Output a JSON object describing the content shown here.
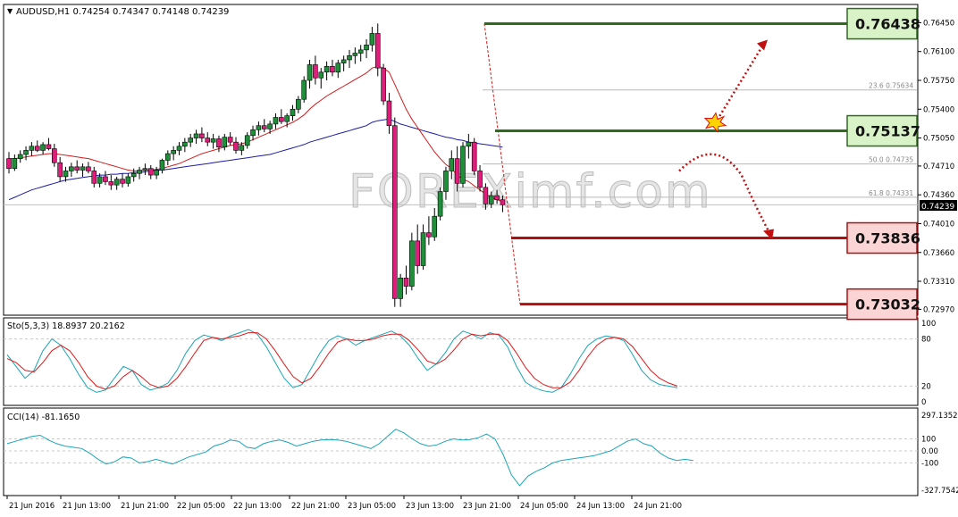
{
  "symbol_header": "AUDUSD,H1  0.74254 0.74347 0.74148 0.74239",
  "watermark": "FOREXimf.com",
  "chart_data": {
    "type": "candlestick",
    "price_axis": {
      "ticks": [
        "0.76450",
        "0.76100",
        "0.75750",
        "0.75400",
        "0.75050",
        "0.74710",
        "0.74360",
        "0.74010",
        "0.73660",
        "0.73310",
        "0.72970"
      ],
      "tick_values": [
        0.7645,
        0.761,
        0.7575,
        0.754,
        0.7505,
        0.7471,
        0.7436,
        0.7401,
        0.7366,
        0.7331,
        0.7297
      ],
      "current_price": "0.74239",
      "range": [
        0.7292,
        0.7665
      ]
    },
    "time_axis": [
      "21 Jun 2016",
      "21 Jun 13:00",
      "21 Jun 21:00",
      "22 Jun 05:00",
      "22 Jun 13:00",
      "22 Jun 21:00",
      "23 Jun 05:00",
      "23 Jun 13:00",
      "23 Jun 21:00",
      "24 Jun 05:00",
      "24 Jun 13:00",
      "24 Jun 21:00"
    ],
    "candles": [
      [
        0.748,
        0.7488,
        0.7462,
        0.7468
      ],
      [
        0.7468,
        0.7485,
        0.7465,
        0.748
      ],
      [
        0.748,
        0.749,
        0.7475,
        0.7485
      ],
      [
        0.7485,
        0.7495,
        0.7478,
        0.749
      ],
      [
        0.749,
        0.75,
        0.7483,
        0.7495
      ],
      [
        0.7495,
        0.7502,
        0.7488,
        0.749
      ],
      [
        0.749,
        0.75,
        0.7485,
        0.7497
      ],
      [
        0.7497,
        0.7505,
        0.749,
        0.7492
      ],
      [
        0.7492,
        0.7498,
        0.747,
        0.7475
      ],
      [
        0.7475,
        0.7482,
        0.7452,
        0.7458
      ],
      [
        0.7458,
        0.747,
        0.7452,
        0.7465
      ],
      [
        0.7465,
        0.7475,
        0.7458,
        0.747
      ],
      [
        0.747,
        0.7478,
        0.7462,
        0.7466
      ],
      [
        0.7466,
        0.7474,
        0.7458,
        0.747
      ],
      [
        0.747,
        0.7476,
        0.7462,
        0.7465
      ],
      [
        0.7465,
        0.747,
        0.7445,
        0.745
      ],
      [
        0.745,
        0.7462,
        0.7445,
        0.7458
      ],
      [
        0.7458,
        0.7465,
        0.7448,
        0.7452
      ],
      [
        0.7452,
        0.746,
        0.7442,
        0.7448
      ],
      [
        0.7448,
        0.7458,
        0.7442,
        0.7455
      ],
      [
        0.7455,
        0.7462,
        0.7445,
        0.745
      ],
      [
        0.745,
        0.7462,
        0.7446,
        0.7458
      ],
      [
        0.7458,
        0.7468,
        0.7452,
        0.7462
      ],
      [
        0.7462,
        0.747,
        0.7455,
        0.7466
      ],
      [
        0.7466,
        0.7474,
        0.746,
        0.7468
      ],
      [
        0.7468,
        0.7472,
        0.7455,
        0.746
      ],
      [
        0.746,
        0.747,
        0.7455,
        0.7466
      ],
      [
        0.7466,
        0.748,
        0.7462,
        0.7478
      ],
      [
        0.7478,
        0.749,
        0.7472,
        0.7486
      ],
      [
        0.7486,
        0.7495,
        0.7478,
        0.749
      ],
      [
        0.749,
        0.75,
        0.7484,
        0.7495
      ],
      [
        0.7495,
        0.7505,
        0.7488,
        0.75
      ],
      [
        0.75,
        0.751,
        0.7494,
        0.7505
      ],
      [
        0.7505,
        0.7515,
        0.7498,
        0.751
      ],
      [
        0.751,
        0.7518,
        0.75,
        0.7505
      ],
      [
        0.7505,
        0.7512,
        0.7495,
        0.75
      ],
      [
        0.75,
        0.751,
        0.7492,
        0.7504
      ],
      [
        0.7504,
        0.7508,
        0.7488,
        0.7494
      ],
      [
        0.7494,
        0.751,
        0.749,
        0.7506
      ],
      [
        0.7506,
        0.7512,
        0.7496,
        0.75
      ],
      [
        0.75,
        0.7506,
        0.7486,
        0.749
      ],
      [
        0.749,
        0.75,
        0.7484,
        0.7496
      ],
      [
        0.7496,
        0.7512,
        0.7492,
        0.7508
      ],
      [
        0.7508,
        0.752,
        0.7502,
        0.7515
      ],
      [
        0.7515,
        0.7525,
        0.7508,
        0.752
      ],
      [
        0.752,
        0.7528,
        0.7512,
        0.7516
      ],
      [
        0.7516,
        0.7526,
        0.751,
        0.7522
      ],
      [
        0.7522,
        0.7535,
        0.7516,
        0.753
      ],
      [
        0.753,
        0.754,
        0.7522,
        0.7525
      ],
      [
        0.7525,
        0.7535,
        0.7518,
        0.7532
      ],
      [
        0.7532,
        0.7545,
        0.7526,
        0.754
      ],
      [
        0.754,
        0.7556,
        0.7535,
        0.7552
      ],
      [
        0.7552,
        0.758,
        0.7548,
        0.7575
      ],
      [
        0.7575,
        0.76,
        0.7565,
        0.7594
      ],
      [
        0.7594,
        0.7605,
        0.757,
        0.7578
      ],
      [
        0.7578,
        0.759,
        0.7565,
        0.7585
      ],
      [
        0.7585,
        0.7598,
        0.7575,
        0.7592
      ],
      [
        0.7592,
        0.76,
        0.758,
        0.7585
      ],
      [
        0.7585,
        0.76,
        0.7578,
        0.7596
      ],
      [
        0.7596,
        0.7605,
        0.7586,
        0.76
      ],
      [
        0.76,
        0.7612,
        0.759,
        0.7605
      ],
      [
        0.7605,
        0.7615,
        0.7595,
        0.7608
      ],
      [
        0.7608,
        0.7618,
        0.7598,
        0.7612
      ],
      [
        0.7612,
        0.7625,
        0.7602,
        0.7618
      ],
      [
        0.7618,
        0.764,
        0.761,
        0.7632
      ],
      [
        0.7632,
        0.7644,
        0.758,
        0.759
      ],
      [
        0.759,
        0.7595,
        0.7545,
        0.755
      ],
      [
        0.755,
        0.756,
        0.751,
        0.752
      ],
      [
        0.752,
        0.753,
        0.73,
        0.731
      ],
      [
        0.731,
        0.734,
        0.73,
        0.7335
      ],
      [
        0.7335,
        0.735,
        0.7315,
        0.7325
      ],
      [
        0.7325,
        0.739,
        0.732,
        0.738
      ],
      [
        0.738,
        0.74,
        0.734,
        0.735
      ],
      [
        0.735,
        0.74,
        0.7345,
        0.739
      ],
      [
        0.739,
        0.741,
        0.7375,
        0.7385
      ],
      [
        0.7385,
        0.742,
        0.738,
        0.741
      ],
      [
        0.741,
        0.7445,
        0.7405,
        0.744
      ],
      [
        0.744,
        0.747,
        0.743,
        0.7465
      ],
      [
        0.7465,
        0.749,
        0.7455,
        0.748
      ],
      [
        0.748,
        0.7495,
        0.744,
        0.745
      ],
      [
        0.745,
        0.75,
        0.7445,
        0.7495
      ],
      [
        0.7495,
        0.751,
        0.748,
        0.75
      ],
      [
        0.75,
        0.7505,
        0.746,
        0.7465
      ],
      [
        0.7465,
        0.7472,
        0.744,
        0.7445
      ],
      [
        0.7445,
        0.745,
        0.7418,
        0.7425
      ],
      [
        0.7425,
        0.744,
        0.742,
        0.7435
      ],
      [
        0.7435,
        0.7442,
        0.7425,
        0.743
      ],
      [
        0.743,
        0.7435,
        0.7415,
        0.7424
      ]
    ],
    "ma_red": [
      0.748,
      0.748,
      0.7481,
      0.7482,
      0.7483,
      0.7484,
      0.7485,
      0.7486,
      0.7486,
      0.7485,
      0.7484,
      0.7483,
      0.7482,
      0.7481,
      0.748,
      0.7478,
      0.7476,
      0.7474,
      0.7472,
      0.747,
      0.7468,
      0.7466,
      0.7465,
      0.7465,
      0.7466,
      0.7466,
      0.7467,
      0.7468,
      0.747,
      0.7472,
      0.7474,
      0.7477,
      0.748,
      0.7483,
      0.7486,
      0.7488,
      0.749,
      0.7492,
      0.7494,
      0.7496,
      0.7497,
      0.7498,
      0.75,
      0.7503,
      0.7506,
      0.7509,
      0.7512,
      0.7515,
      0.7518,
      0.7521,
      0.7524,
      0.7528,
      0.7533,
      0.754,
      0.7546,
      0.7551,
      0.7556,
      0.756,
      0.7564,
      0.7568,
      0.7572,
      0.7576,
      0.758,
      0.7584,
      0.759,
      0.7592,
      0.759,
      0.7585,
      0.757,
      0.7555,
      0.754,
      0.7528,
      0.7518,
      0.7508,
      0.7498,
      0.7488,
      0.748,
      0.7473,
      0.7468,
      0.746,
      0.7455,
      0.7452,
      0.7447,
      0.7442,
      0.7437,
      0.7433,
      0.743,
      0.7428
    ],
    "ma_blue": [
      0.743,
      0.7433,
      0.7436,
      0.7439,
      0.7442,
      0.7444,
      0.7446,
      0.7448,
      0.745,
      0.7452,
      0.7454,
      0.7455,
      0.7456,
      0.7457,
      0.7458,
      0.7459,
      0.746,
      0.746,
      0.7461,
      0.7461,
      0.7462,
      0.7462,
      0.7463,
      0.7463,
      0.7464,
      0.7465,
      0.7466,
      0.7466,
      0.7467,
      0.7468,
      0.7469,
      0.747,
      0.7471,
      0.7472,
      0.7473,
      0.7474,
      0.7475,
      0.7476,
      0.7477,
      0.7478,
      0.7479,
      0.748,
      0.7481,
      0.7482,
      0.7483,
      0.7484,
      0.7485,
      0.7487,
      0.7489,
      0.7491,
      0.7493,
      0.7495,
      0.7497,
      0.75,
      0.7502,
      0.7504,
      0.7506,
      0.7508,
      0.751,
      0.7512,
      0.7514,
      0.7516,
      0.7518,
      0.752,
      0.7524,
      0.7526,
      0.7527,
      0.7528,
      0.7525,
      0.7522,
      0.752,
      0.7518,
      0.7516,
      0.7514,
      0.7512,
      0.751,
      0.7508,
      0.7506,
      0.7505,
      0.7503,
      0.7502,
      0.75,
      0.7499,
      0.7498,
      0.7497,
      0.7496,
      0.7495,
      0.7494
    ],
    "levels": [
      {
        "label": "0.76438",
        "value": 0.76438,
        "kind": "resistance",
        "color": "#2e6b1e",
        "box_bg": "#d9f2c7"
      },
      {
        "label": "0.75137",
        "value": 0.75137,
        "kind": "resistance",
        "color": "#2e6b1e",
        "box_bg": "#d9f2c7"
      },
      {
        "label": "0.73836",
        "value": 0.73836,
        "kind": "support",
        "color": "#b01010",
        "box_bg": "#fbd5d5"
      },
      {
        "label": "0.73032",
        "value": 0.73032,
        "kind": "support",
        "color": "#b01010",
        "box_bg": "#fbd5d5"
      }
    ],
    "fib_levels": [
      {
        "label": "23.6 0.75634",
        "value": 0.75634
      },
      {
        "label": "50.0 0.74735",
        "value": 0.74735
      },
      {
        "label": "61.8 0.74331",
        "value": 0.74331
      }
    ],
    "stochastic": {
      "label": "Sto(5,3,3) 18.8937 20.2162",
      "ticks": [
        "100",
        "80",
        "20",
        "0"
      ],
      "tick_values": [
        100,
        80,
        20,
        0
      ],
      "k": [
        60,
        45,
        30,
        40,
        65,
        80,
        72,
        55,
        35,
        18,
        12,
        15,
        30,
        45,
        40,
        22,
        15,
        18,
        24,
        40,
        62,
        78,
        85,
        82,
        78,
        84,
        88,
        92,
        86,
        70,
        50,
        30,
        18,
        22,
        42,
        62,
        78,
        84,
        80,
        72,
        78,
        82,
        86,
        90,
        84,
        72,
        55,
        40,
        48,
        62,
        80,
        90,
        86,
        80,
        88,
        85,
        70,
        45,
        25,
        18,
        14,
        12,
        18,
        35,
        55,
        72,
        80,
        84,
        82,
        78,
        60,
        40,
        28,
        22,
        20,
        18
      ],
      "d": [
        55,
        50,
        40,
        38,
        50,
        65,
        72,
        65,
        50,
        32,
        20,
        16,
        20,
        32,
        40,
        32,
        22,
        18,
        20,
        30,
        45,
        62,
        78,
        82,
        80,
        82,
        84,
        88,
        88,
        80,
        65,
        48,
        32,
        24,
        30,
        45,
        62,
        76,
        80,
        78,
        78,
        80,
        84,
        86,
        86,
        78,
        66,
        52,
        48,
        54,
        66,
        80,
        86,
        84,
        86,
        86,
        78,
        62,
        44,
        30,
        22,
        18,
        18,
        25,
        40,
        58,
        72,
        80,
        82,
        80,
        70,
        55,
        40,
        30,
        24,
        20
      ]
    },
    "cci": {
      "label": "CCI(14) -81.1650",
      "ticks": [
        "297.1352",
        "100",
        "0.00",
        "-100",
        "-327.7542"
      ],
      "tick_values": [
        297.1352,
        100,
        0,
        -100,
        -327.7542
      ],
      "values": [
        60,
        80,
        100,
        120,
        130,
        90,
        60,
        40,
        30,
        20,
        -20,
        -70,
        -110,
        -90,
        -50,
        -60,
        -100,
        -90,
        -70,
        -90,
        -110,
        -80,
        -50,
        -30,
        -10,
        40,
        60,
        90,
        80,
        30,
        20,
        60,
        80,
        90,
        70,
        40,
        60,
        80,
        90,
        95,
        90,
        80,
        60,
        40,
        20,
        60,
        120,
        180,
        150,
        100,
        60,
        40,
        50,
        80,
        100,
        90,
        95,
        110,
        140,
        100,
        -30,
        -200,
        -290,
        -210,
        -170,
        -140,
        -100,
        -80,
        -70,
        -60,
        -50,
        -40,
        -20,
        0,
        40,
        80,
        100,
        60,
        40,
        -20,
        -60,
        -80,
        -70,
        -81
      ]
    }
  }
}
